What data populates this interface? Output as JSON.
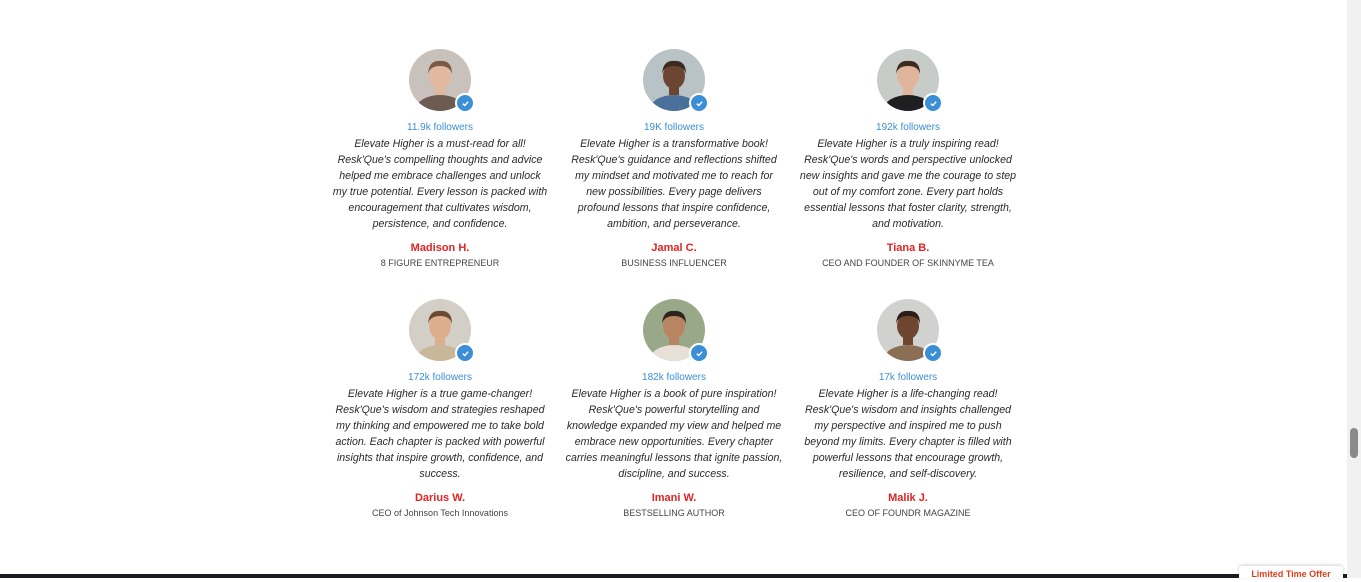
{
  "testimonials": [
    {
      "followers": "11.9k followers",
      "quote": "Elevate Higher is a must-read for all! Resk'Que's compelling thoughts and advice helped me embrace challenges and unlock my true potential. Every lesson is packed with encouragement that cultivates wisdom, persistence, and confidence.",
      "name": "Madison H.",
      "role": "8 FIGURE ENTREPRENEUR",
      "avatar": {
        "bg": "#c9c1bb",
        "skin": "#e2b9a0",
        "hair": "#7a5a45",
        "shirt": "#6d5b52"
      }
    },
    {
      "followers": "19K followers",
      "quote": "Elevate Higher is a transformative book! Resk'Que's guidance and reflections shifted my mindset and motivated me to reach for new possibilities. Every page delivers profound lessons that inspire confidence, ambition, and perseverance.",
      "name": "Jamal C.",
      "role": "BUSINESS INFLUENCER",
      "avatar": {
        "bg": "#b9c2c4",
        "skin": "#6b4532",
        "hair": "#3a2a22",
        "shirt": "#4a6f9a"
      }
    },
    {
      "followers": "192k followers",
      "quote": "Elevate Higher is a truly inspiring read! Resk'Que's words and perspective unlocked new insights and gave me the courage to step out of my comfort zone. Every part holds essential lessons that foster clarity, strength, and motivation.",
      "name": "Tiana B.",
      "role": "CEO AND FOUNDER OF SKINNYME TEA",
      "avatar": {
        "bg": "#c7ccc9",
        "skin": "#e1b59b",
        "hair": "#3d2c22",
        "shirt": "#1f1f22"
      }
    },
    {
      "followers": "172k followers",
      "quote": "Elevate Higher is a true game-changer! Resk'Que's wisdom and strategies reshaped my thinking and empowered me to take bold action. Each chapter is packed with powerful insights that inspire growth, confidence, and success.",
      "name": "Darius W.",
      "role": "CEO of Johnson Tech Innovations",
      "avatar": {
        "bg": "#d3cfc6",
        "skin": "#dcae8e",
        "hair": "#6b4a32",
        "shirt": "#c9b79a"
      }
    },
    {
      "followers": "182k followers",
      "quote": "Elevate Higher is a book of pure inspiration! Resk'Que's powerful storytelling and knowledge expanded my view and helped me embrace new opportunities. Every chapter carries meaningful lessons that ignite passion, discipline, and success.",
      "name": "Imani W.",
      "role": "BESTSELLING AUTHOR",
      "avatar": {
        "bg": "#9aa88a",
        "skin": "#b88462",
        "hair": "#2e241d",
        "shirt": "#e6e0d6"
      }
    },
    {
      "followers": "17k followers",
      "quote": "Elevate Higher is a life-changing read! Resk'Que's wisdom and insights challenged my perspective and inspired me to push beyond my limits. Every chapter is filled with powerful lessons that encourage growth, resilience, and self-discovery.",
      "name": "Malik J.",
      "role": "CEO OF FOUNDR MAGAZINE",
      "avatar": {
        "bg": "#d1d1cf",
        "skin": "#6e4630",
        "hair": "#2a1e18",
        "shirt": "#8a6f54"
      }
    }
  ],
  "offer_tab": "Limited Time Offer",
  "icons": {
    "verified": "verified-check-icon"
  },
  "colors": {
    "name": "#e02424",
    "followers": "#3a8fd6",
    "offer": "#e0401a"
  }
}
